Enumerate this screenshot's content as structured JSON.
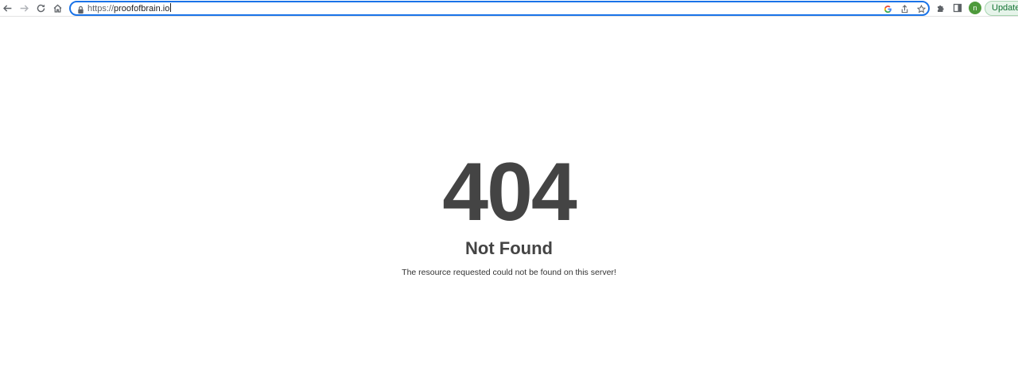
{
  "browser": {
    "url_scheme": "https://",
    "url_host": "proofofbrain.io",
    "profile_initial": "n",
    "update_label": "Update",
    "icons": {
      "back": "back-arrow-icon",
      "forward": "forward-arrow-icon",
      "reload": "reload-icon",
      "home": "home-icon",
      "lock": "lock-icon",
      "google": "google-icon",
      "share": "share-icon",
      "bookmark": "star-icon",
      "extensions": "puzzle-icon",
      "side_panel": "side-panel-icon"
    },
    "colors": {
      "omnibox_focus": "#1a73e8",
      "avatar": "#4e9a3c",
      "update_text": "#137333",
      "update_bg": "#e6f4ea"
    }
  },
  "page": {
    "code": "404",
    "title": "Not Found",
    "message": "The resource requested could not be found on this server!",
    "text_color": "#444444"
  }
}
